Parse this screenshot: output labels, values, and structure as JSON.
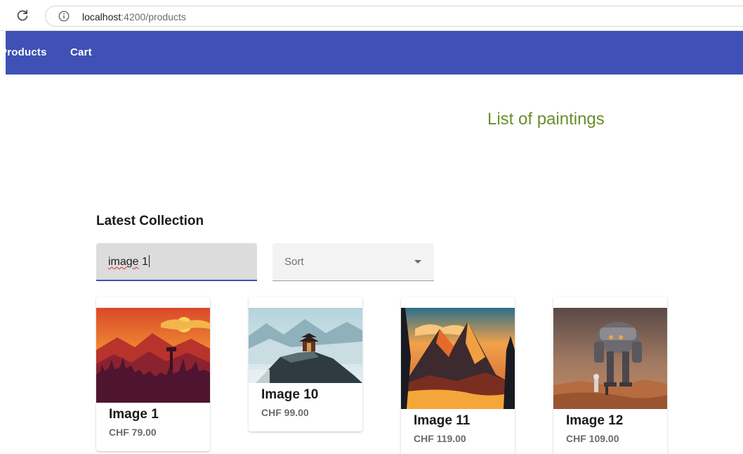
{
  "browser": {
    "url_host": "localhost",
    "url_rest": ":4200/products"
  },
  "nav": {
    "products_label": "Products",
    "cart_label": "Cart",
    "bar_color": "#3f51b5"
  },
  "page_title": "List of paintings",
  "section_title": "Latest Collection",
  "search": {
    "value_word": "image",
    "value_rest": " 1"
  },
  "sort": {
    "label": "Sort"
  },
  "products": [
    {
      "name": "Image 1",
      "price": "CHF 79.00"
    },
    {
      "name": "Image 10",
      "price": "CHF 99.00"
    },
    {
      "name": "Image 11",
      "price": "CHF 119.00"
    },
    {
      "name": "Image 12",
      "price": "CHF 109.00"
    }
  ]
}
